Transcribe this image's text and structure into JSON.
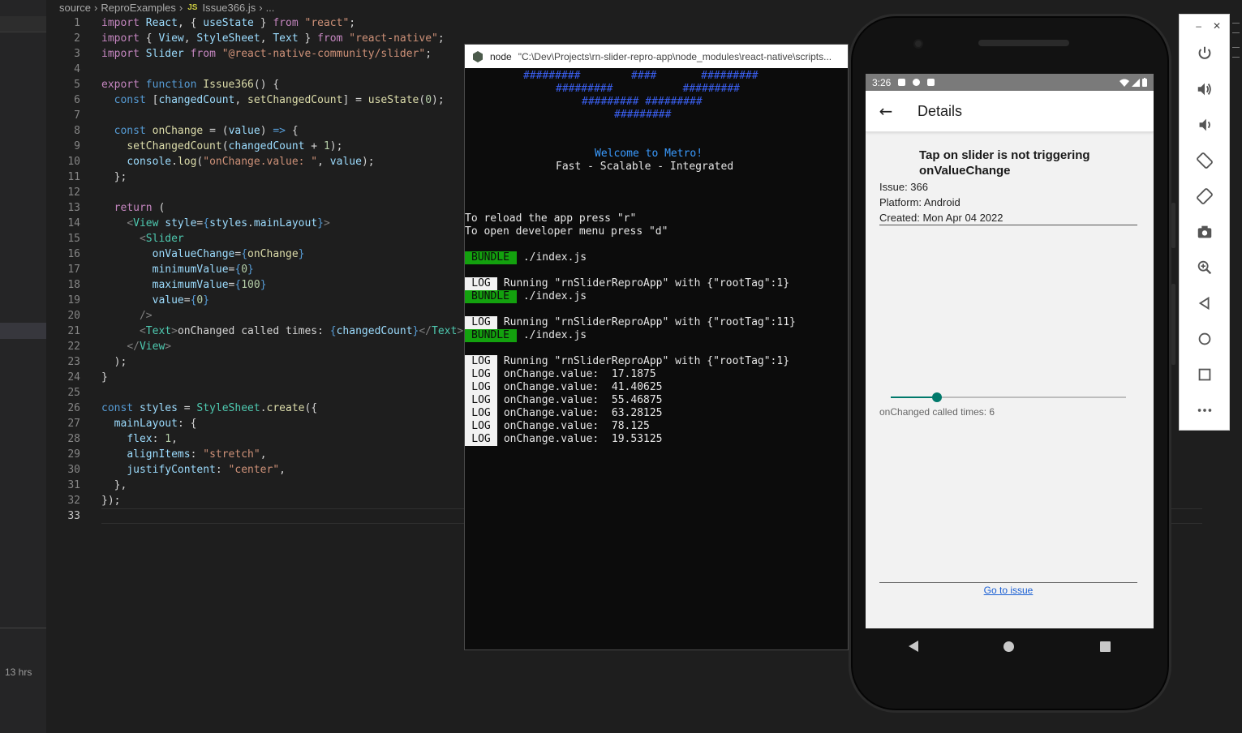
{
  "editor": {
    "breadcrumb": {
      "folder1": "source",
      "folder2": "ReproExamples",
      "file_type": "JS",
      "file": "Issue366.js",
      "more": "..."
    },
    "left_panel": {
      "time_label": "13 hrs"
    }
  },
  "terminal": {
    "title_app": "node",
    "title_path": "\"C:\\Dev\\Projects\\rn-slider-repro-app\\node_modules\\react-native\\scripts...",
    "logo": [
      "#########        ####       #########",
      "#########           #########",
      "######### #########",
      "#########"
    ],
    "welcome": "Welcome to Metro!",
    "tagline": "Fast - Scalable - Integrated",
    "reload_hint": "To reload the app press \"r\"",
    "devmenu_hint": "To open developer menu press \"d\"",
    "bundle_tag": "BUNDLE",
    "log_tag": "LOG",
    "bundle_path": "./index.js",
    "run1": "Running \"rnSliderReproApp\" with {\"rootTag\":1}",
    "run2": "Running \"rnSliderReproApp\" with {\"rootTag\":11}",
    "run3": "Running \"rnSliderReproApp\" with {\"rootTag\":1}",
    "logs": [
      "onChange.value:  17.1875",
      "onChange.value:  41.40625",
      "onChange.value:  55.46875",
      "onChange.value:  63.28125",
      "onChange.value:  78.125",
      "onChange.value:  19.53125"
    ]
  },
  "phone": {
    "status_time": "3:26",
    "app_title": "Details",
    "issue_title": "Tap on slider is not triggering onValueChange",
    "issue_number": "Issue: 366",
    "platform": "Platform:  Android",
    "created": "Created: Mon Apr 04 2022",
    "slider": {
      "value_fraction": 0.195,
      "accent_color": "#00796b"
    },
    "changed_text": "onChanged called times: 6",
    "link_text": "Go to issue"
  },
  "emulator": {
    "minimize": "–",
    "close": "✕",
    "buttons": [
      "power-icon",
      "volume-up-icon",
      "volume-down-icon",
      "rotate-left-icon",
      "rotate-right-icon",
      "camera-icon",
      "zoom-icon",
      "back-icon",
      "home-icon",
      "overview-icon",
      "more-icon"
    ]
  }
}
